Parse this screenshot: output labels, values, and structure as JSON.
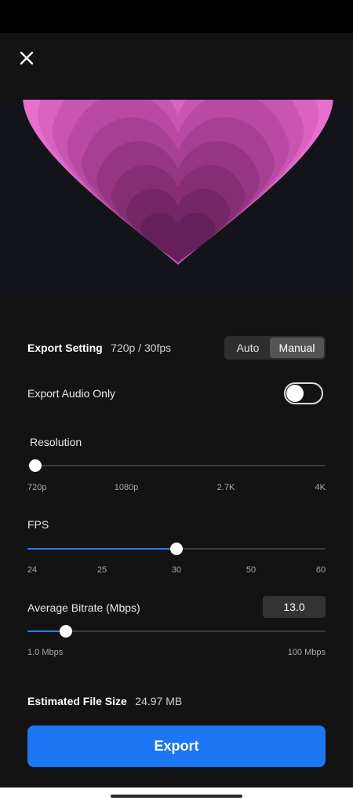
{
  "export_setting": {
    "label": "Export Setting",
    "value": "720p / 30fps"
  },
  "mode": {
    "options": [
      "Auto",
      "Manual"
    ],
    "selected": "Manual"
  },
  "audio_only": {
    "label": "Export Audio Only",
    "enabled": false
  },
  "resolution": {
    "label": "Resolution",
    "ticks": [
      "720p",
      "1080p",
      "2.7K",
      "4K"
    ],
    "selected": "720p"
  },
  "fps": {
    "label": "FPS",
    "ticks": [
      "24",
      "25",
      "30",
      "50",
      "60"
    ],
    "selected": "30"
  },
  "bitrate": {
    "label": "Average Bitrate (Mbps)",
    "value": "13.0",
    "min_label": "1.0 Mbps",
    "max_label": "100 Mbps",
    "value_number": 13.0,
    "min_number": 1.0,
    "max_number": 100
  },
  "file_size": {
    "label": "Estimated File Size",
    "value": "24.97 MB"
  },
  "export_button": {
    "label": "Export"
  },
  "colors": {
    "accent": "#1d76f2",
    "slider_fill": "#2f7bf5",
    "background": "#131313"
  },
  "icons": {
    "close": "close-icon"
  }
}
